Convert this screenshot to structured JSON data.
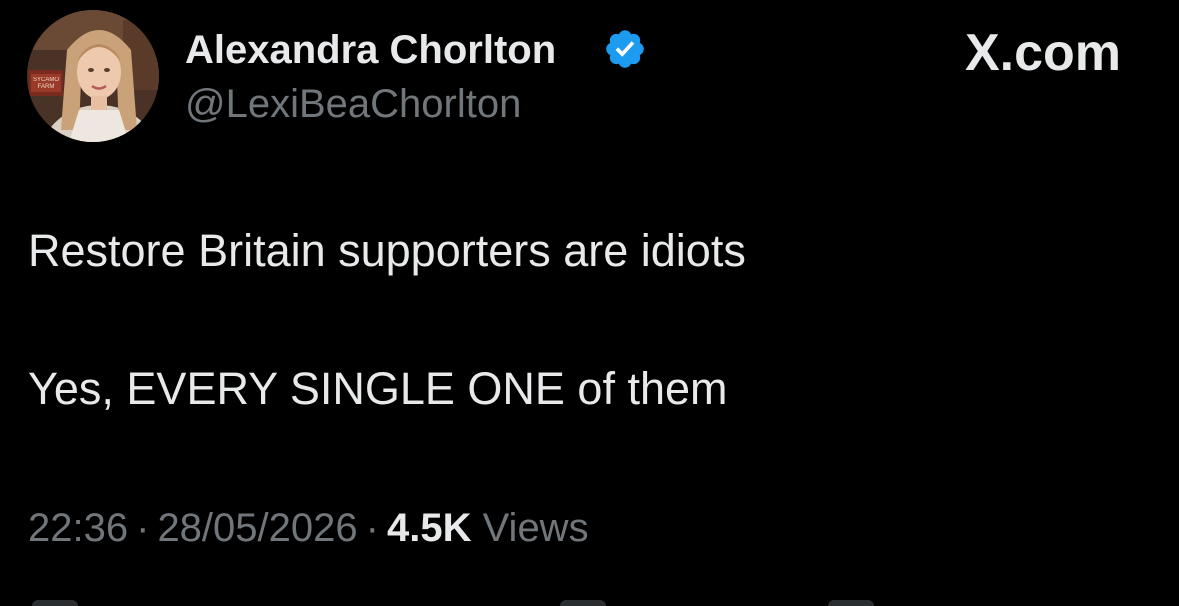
{
  "author": {
    "display_name": "Alexandra Chorlton",
    "handle": "@LexiBeaChorlton",
    "verified_icon": "verified-badge-icon",
    "avatar_sign_text": "SYCAMO FARM"
  },
  "brand": {
    "label": "X.com"
  },
  "tweet": {
    "lines": [
      "Restore Britain supporters are idiots",
      "Yes, EVERY SINGLE ONE of them"
    ],
    "time": "22:36",
    "separator": "·",
    "date": "28/05/2026",
    "views_count": "4.5K",
    "views_label": "Views"
  },
  "colors": {
    "background": "#000000",
    "primary_text": "#e7e9ea",
    "secondary_text": "#71767b",
    "verified_blue": "#1d9bf0"
  }
}
